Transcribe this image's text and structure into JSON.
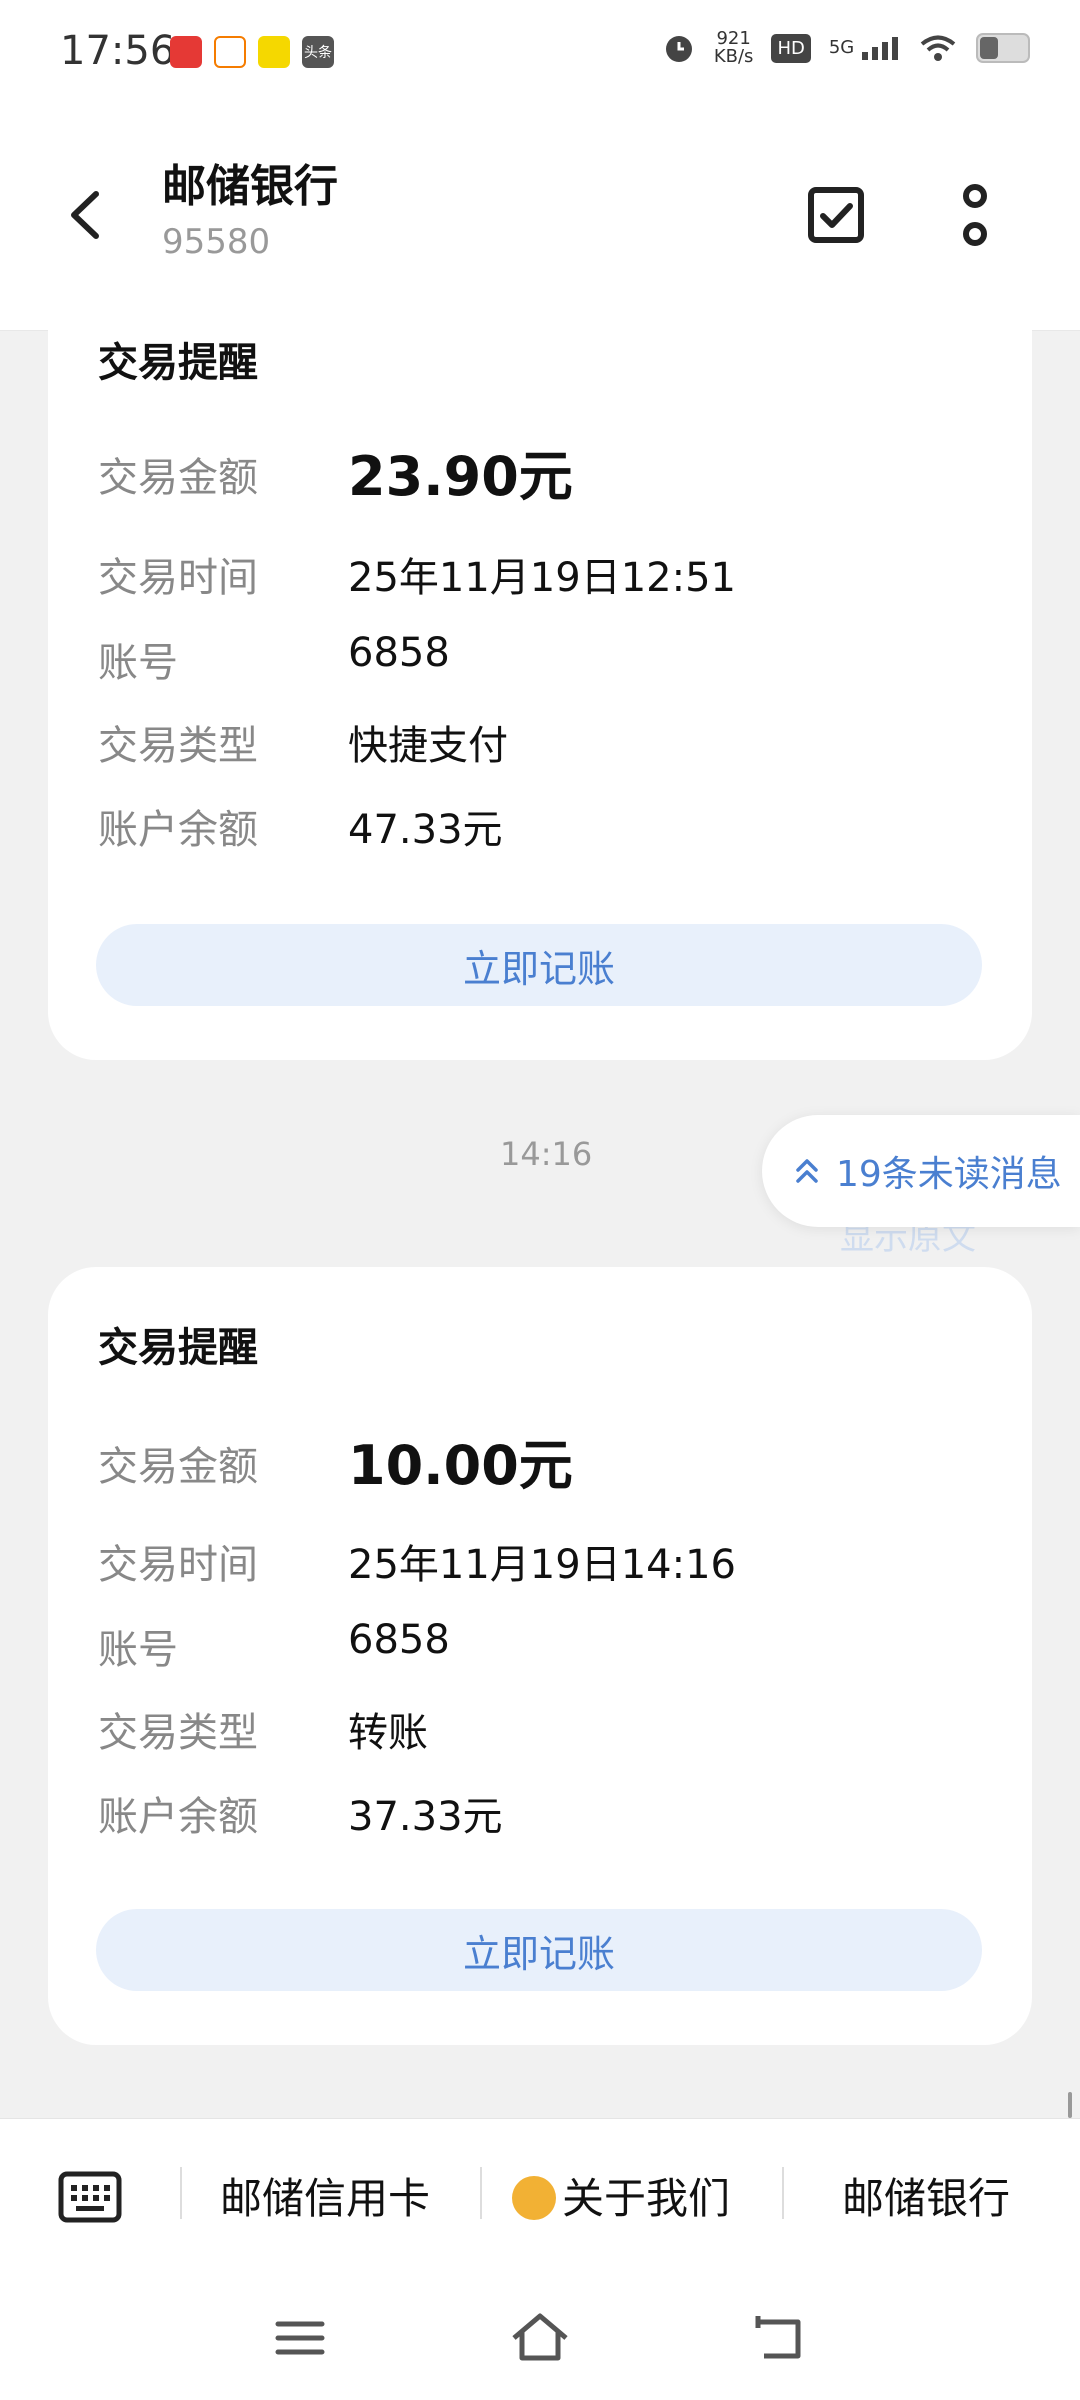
{
  "status_bar": {
    "time": "17:56",
    "app_icons": [
      "app-icon-1",
      "app-icon-2",
      "app-icon-3",
      "toutiao-icon"
    ],
    "toutiao_label": "头条",
    "net_speed_value": "921",
    "net_speed_unit": "KB/s",
    "hd_label": "HD",
    "network_label": "5G"
  },
  "header": {
    "title": "邮储银行",
    "subtitle": "95580"
  },
  "messages": [
    {
      "title": "交易提醒",
      "rows": [
        {
          "label": "交易金额",
          "value": "23.90元"
        },
        {
          "label": "交易时间",
          "value": "25年11月19日12:51"
        },
        {
          "label": "账号",
          "value": "6858"
        },
        {
          "label": "交易类型",
          "value": "快捷支付"
        },
        {
          "label": "账户余额",
          "value": "47.33元"
        }
      ],
      "button_label": "立即记账"
    },
    {
      "title": "交易提醒",
      "rows": [
        {
          "label": "交易金额",
          "value": "10.00元"
        },
        {
          "label": "交易时间",
          "value": "25年11月19日14:16"
        },
        {
          "label": "账号",
          "value": "6858"
        },
        {
          "label": "交易类型",
          "value": "转账"
        },
        {
          "label": "账户余额",
          "value": "37.33元"
        }
      ],
      "button_label": "立即记账"
    }
  ],
  "timestamp": "14:16",
  "unread_badge": "19条未读消息",
  "show_original": "显示原文",
  "menu": {
    "items": [
      "邮储信用卡",
      "关于我们",
      "邮储银行"
    ]
  },
  "colors": {
    "accent": "#4a7fd0",
    "button_bg": "#e8f0fb",
    "page_bg": "#f1f1f1"
  }
}
